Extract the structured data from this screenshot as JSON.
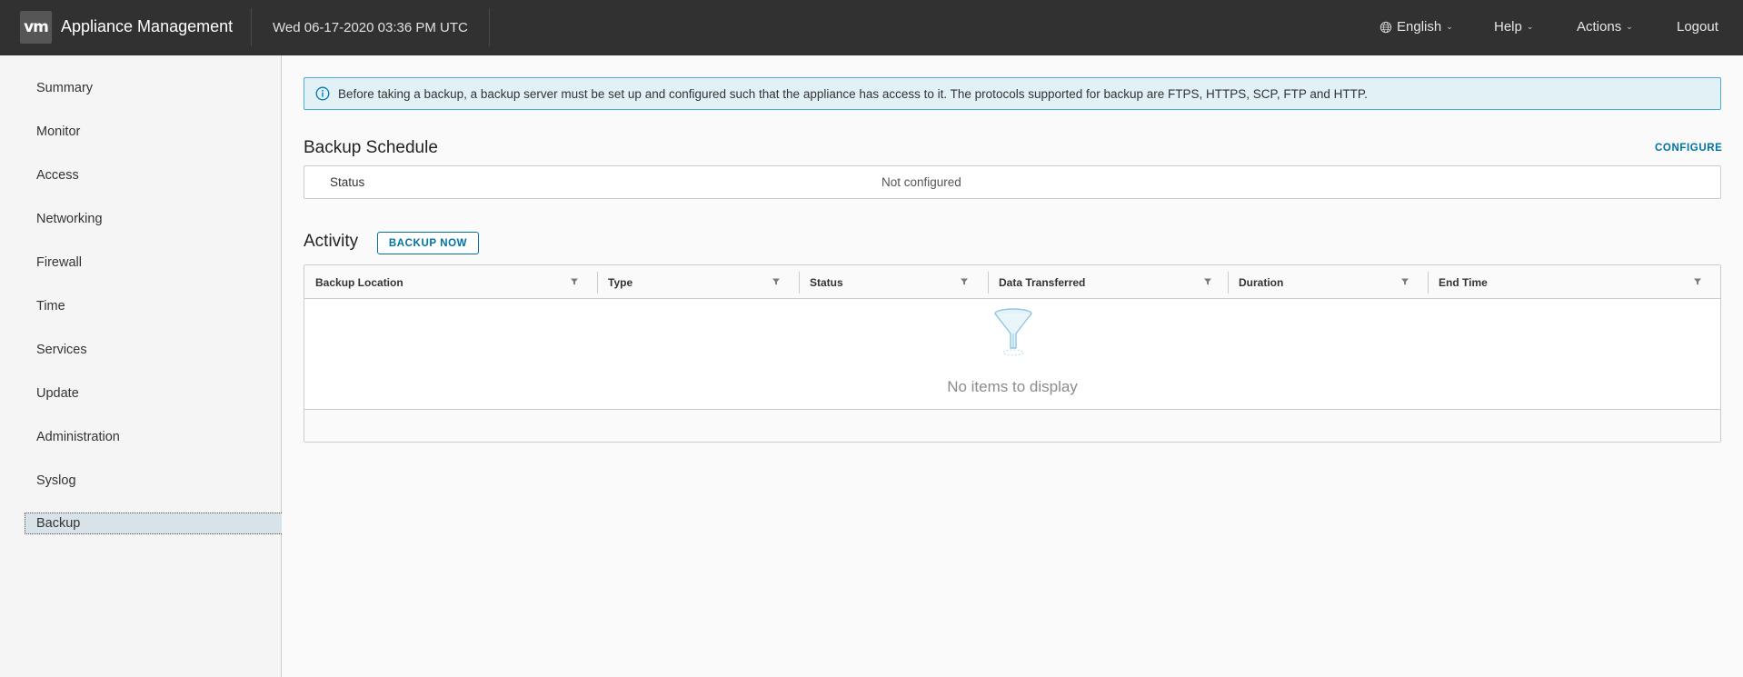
{
  "header": {
    "logo_text": "vm",
    "title": "Appliance Management",
    "datetime": "Wed 06-17-2020 03:36 PM UTC",
    "language": "English",
    "help": "Help",
    "actions": "Actions",
    "logout": "Logout",
    "background_color": "#313131"
  },
  "sidebar": {
    "items": [
      {
        "label": "Summary"
      },
      {
        "label": "Monitor"
      },
      {
        "label": "Access"
      },
      {
        "label": "Networking"
      },
      {
        "label": "Firewall"
      },
      {
        "label": "Time"
      },
      {
        "label": "Services"
      },
      {
        "label": "Update"
      },
      {
        "label": "Administration"
      },
      {
        "label": "Syslog"
      },
      {
        "label": "Backup",
        "active": true
      }
    ]
  },
  "alert": {
    "icon": "info-icon",
    "text": "Before taking a backup, a backup server must be set up and configured such that the appliance has access to it. The protocols supported for backup are FTPS, HTTPS, SCP, FTP and HTTP."
  },
  "schedule": {
    "title": "Backup Schedule",
    "configure_label": "CONFIGURE",
    "status_key": "Status",
    "status_value": "Not configured"
  },
  "activity": {
    "title": "Activity",
    "backup_now_label": "BACKUP NOW",
    "columns": [
      {
        "label": "Backup Location"
      },
      {
        "label": "Type"
      },
      {
        "label": "Status"
      },
      {
        "label": "Data Transferred"
      },
      {
        "label": "Duration"
      },
      {
        "label": "End Time"
      }
    ],
    "empty_text": "No items to display"
  },
  "colors": {
    "accent": "#0072a3",
    "alert_bg": "#e1f1f6",
    "alert_border": "#49afd9",
    "active_nav_bg": "#d8e3e9"
  }
}
